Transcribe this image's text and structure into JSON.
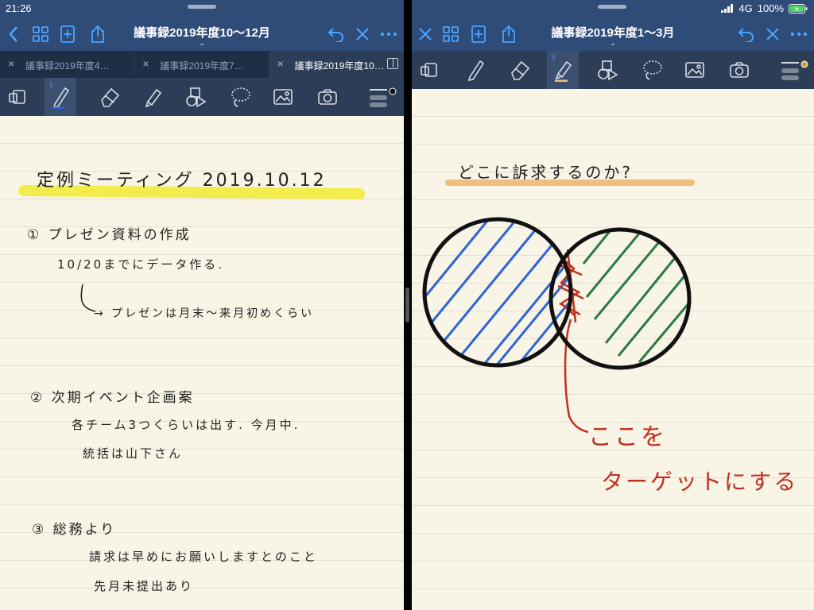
{
  "status": {
    "time": "21:26",
    "network": "4G",
    "battery": "100%"
  },
  "left_doc": {
    "title": "議事録2019年度10〜12月",
    "tabs": [
      {
        "label": "議事録2019年度4…",
        "active": false
      },
      {
        "label": "議事録2019年度7…",
        "active": false
      },
      {
        "label": "議事録2019年度10…",
        "active": true
      }
    ],
    "notes": {
      "heading": "定例ミーティング 2019.10.12",
      "item1_title": "① プレゼン資料の作成",
      "item1_line1": "10/20までにデータ作る.",
      "item1_line2": "→ プレゼンは月末〜来月初めくらい",
      "item2_title": "② 次期イベント企画案",
      "item2_line1": "各チーム3つくらいは出す. 今月中.",
      "item2_line2": "統括は山下さん",
      "item3_title": "③ 総務より",
      "item3_line1": "請求は早めにお願いしますとのこと",
      "item3_line2": "先月未提出あり"
    }
  },
  "right_doc": {
    "title": "議事録2019年度1〜3月",
    "notes": {
      "question": "どこに訴求するのか?",
      "target_line1": "ここを",
      "target_line2": "ターゲットにする"
    }
  },
  "colors": {
    "nav": "#2f4c78",
    "toolbar": "#2c3e57",
    "paper": "#f8f4e6",
    "highlight_yellow": "#f2ec3c",
    "highlight_orange": "#eebf7e",
    "blue_ink": "#2f63d8",
    "green_ink": "#2d7a43",
    "red_ink": "#c0311f"
  }
}
